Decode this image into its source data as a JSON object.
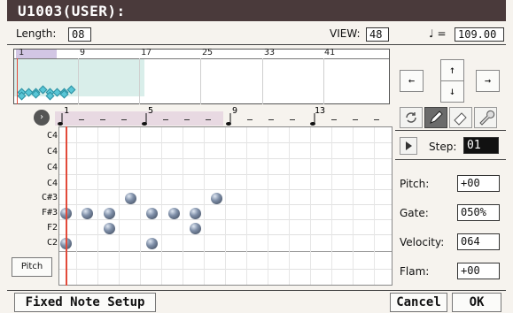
{
  "title": "U1003(USER):",
  "length": {
    "label": "Length:",
    "value": "08"
  },
  "view": {
    "label": "VIEW:",
    "value": "48"
  },
  "tempo": {
    "symbol": "♩ =",
    "value": "109.00"
  },
  "overview": {
    "ruler": [
      "1",
      "9",
      "17",
      "25",
      "33",
      "41"
    ]
  },
  "nav_arrows": {
    "up": "↑",
    "down": "↓",
    "left": "←",
    "right": "→"
  },
  "beat_ruler": [
    "1",
    "5",
    "9",
    "13"
  ],
  "row_labels": [
    "C4",
    "C4",
    "C4",
    "C4",
    "C#3",
    "F#3",
    "F2",
    "C2"
  ],
  "pitch_button": "Pitch",
  "step": {
    "label": "Step:",
    "value": "01"
  },
  "params": [
    {
      "label": "Pitch:",
      "value": "+00"
    },
    {
      "label": "Gate:",
      "value": "050%"
    },
    {
      "label": "Velocity:",
      "value": "064"
    },
    {
      "label": "Flam:",
      "value": "+00"
    }
  ],
  "buttons": {
    "fixed_note_setup": "Fixed Note Setup",
    "cancel": "Cancel",
    "ok": "OK"
  },
  "notes": [
    {
      "step": 1,
      "row": 5
    },
    {
      "step": 1,
      "row": 7
    },
    {
      "step": 2,
      "row": 5
    },
    {
      "step": 3,
      "row": 5
    },
    {
      "step": 3,
      "row": 6
    },
    {
      "step": 4,
      "row": 4
    },
    {
      "step": 5,
      "row": 5
    },
    {
      "step": 5,
      "row": 7
    },
    {
      "step": 6,
      "row": 5
    },
    {
      "step": 7,
      "row": 5
    },
    {
      "step": 7,
      "row": 6
    },
    {
      "step": 8,
      "row": 4
    }
  ],
  "colors": {
    "titlebar": "#4a3a3b",
    "playhead": "#e24a3a",
    "overview_highlight": "#d9eeea",
    "beat_highlight": "#e8d9e2"
  }
}
